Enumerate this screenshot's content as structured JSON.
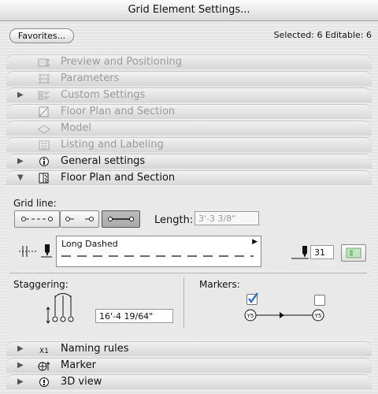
{
  "window": {
    "title": "Grid Element Settings..."
  },
  "toolbar": {
    "favorites_label": "Favorites...",
    "selection_info": "Selected: 6 Editable: 6"
  },
  "sections_top": [
    {
      "label": "Preview and Positioning",
      "icon": "preview-positioning-icon",
      "enabled": false
    },
    {
      "label": "Parameters",
      "icon": "parameters-icon",
      "enabled": false
    },
    {
      "label": "Custom Settings",
      "icon": "custom-settings-icon",
      "enabled": false
    },
    {
      "label": "Floor Plan and Section",
      "icon": "floor-plan-icon",
      "enabled": false
    },
    {
      "label": "Model",
      "icon": "model-icon",
      "enabled": false
    },
    {
      "label": "Listing and Labeling",
      "icon": "listing-labeling-icon",
      "enabled": false
    },
    {
      "label": "General settings",
      "icon": "info-icon",
      "enabled": true
    }
  ],
  "open_section": {
    "label": "Floor Plan and Section",
    "icon": "floor-plan-icon",
    "expanded": true
  },
  "floor_plan": {
    "grid_line_label": "Grid line:",
    "grid_line_options": [
      "line-both-ends-icon",
      "line-start-end-icon",
      "line-full-icon"
    ],
    "grid_line_selected": 2,
    "length_label": "Length:",
    "length_value": "3'-3 3/8\"",
    "line_type_name": "Long Dashed",
    "pen_number": "31",
    "staggering_label": "Staggering:",
    "staggering_value": "16'-4 19/64\"",
    "markers_label": "Markers:",
    "marker_start_checked": true,
    "marker_end_checked": false,
    "marker_text": "Y5"
  },
  "sections_bottom": [
    {
      "label": "Naming rules",
      "icon": "naming-rules-icon"
    },
    {
      "label": "Marker",
      "icon": "marker-icon"
    },
    {
      "label": "3D view",
      "icon": "3d-view-icon"
    }
  ],
  "colors": {
    "checkbox_blue": "#2f6fcf",
    "disabled_text": "#9a9a9a"
  }
}
